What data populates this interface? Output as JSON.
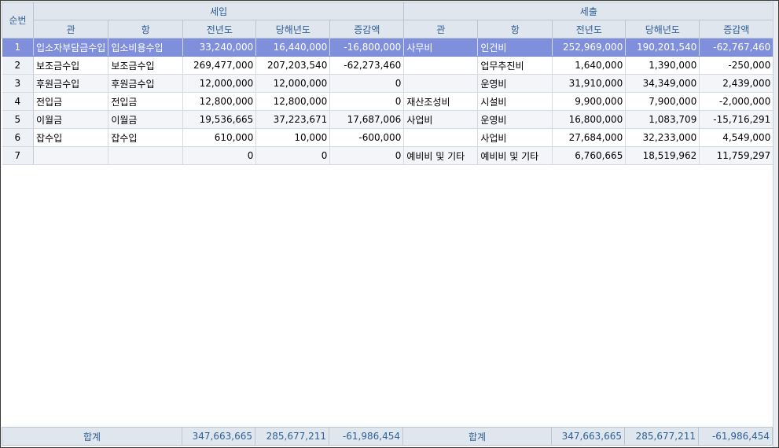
{
  "header": {
    "seq_label": "순번",
    "income_group": "세입",
    "expense_group": "세출",
    "income_cols": [
      "관",
      "항",
      "전년도",
      "당해년도",
      "증감액"
    ],
    "expense_cols": [
      "관",
      "항",
      "전년도",
      "당해년도",
      "증감액"
    ]
  },
  "rows": [
    {
      "seq": "1",
      "in_gwan": "입소자부담금수입",
      "in_hang": "입소비용수입",
      "in_prev": "33,240,000",
      "in_cur": "16,440,000",
      "in_diff": "-16,800,000",
      "ex_gwan": "사무비",
      "ex_hang": "인건비",
      "ex_prev": "252,969,000",
      "ex_cur": "190,201,540",
      "ex_diff": "-62,767,460"
    },
    {
      "seq": "2",
      "in_gwan": "보조금수입",
      "in_hang": "보조금수입",
      "in_prev": "269,477,000",
      "in_cur": "207,203,540",
      "in_diff": "-62,273,460",
      "ex_gwan": "",
      "ex_hang": "업무추진비",
      "ex_prev": "1,640,000",
      "ex_cur": "1,390,000",
      "ex_diff": "-250,000"
    },
    {
      "seq": "3",
      "in_gwan": "후원금수입",
      "in_hang": "후원금수입",
      "in_prev": "12,000,000",
      "in_cur": "12,000,000",
      "in_diff": "0",
      "ex_gwan": "",
      "ex_hang": "운영비",
      "ex_prev": "31,910,000",
      "ex_cur": "34,349,000",
      "ex_diff": "2,439,000"
    },
    {
      "seq": "4",
      "in_gwan": "전입금",
      "in_hang": "전입금",
      "in_prev": "12,800,000",
      "in_cur": "12,800,000",
      "in_diff": "0",
      "ex_gwan": "재산조성비",
      "ex_hang": "시설비",
      "ex_prev": "9,900,000",
      "ex_cur": "7,900,000",
      "ex_diff": "-2,000,000"
    },
    {
      "seq": "5",
      "in_gwan": "이월금",
      "in_hang": "이월금",
      "in_prev": "19,536,665",
      "in_cur": "37,223,671",
      "in_diff": "17,687,006",
      "ex_gwan": "사업비",
      "ex_hang": "운영비",
      "ex_prev": "16,800,000",
      "ex_cur": "1,083,709",
      "ex_diff": "-15,716,291"
    },
    {
      "seq": "6",
      "in_gwan": "잡수입",
      "in_hang": "잡수입",
      "in_prev": "610,000",
      "in_cur": "10,000",
      "in_diff": "-600,000",
      "ex_gwan": "",
      "ex_hang": "사업비",
      "ex_prev": "27,684,000",
      "ex_cur": "32,233,000",
      "ex_diff": "4,549,000"
    },
    {
      "seq": "7",
      "in_gwan": "",
      "in_hang": "",
      "in_prev": "0",
      "in_cur": "0",
      "in_diff": "0",
      "ex_gwan": "예비비 및 기타",
      "ex_hang": "예비비 및 기타",
      "ex_prev": "6,760,665",
      "ex_cur": "18,519,962",
      "ex_diff": "11,759,297"
    }
  ],
  "totals": {
    "income_label": "합계",
    "in_prev": "347,663,665",
    "in_cur": "285,677,211",
    "in_diff": "-61,986,454",
    "expense_label": "합계",
    "ex_prev": "347,663,665",
    "ex_cur": "285,677,211",
    "ex_diff": "-61,986,454"
  },
  "colors": {
    "selected_row": "#7f8fdc",
    "header_bg": "#dfe6ee",
    "header_text": "#2f5f95"
  }
}
